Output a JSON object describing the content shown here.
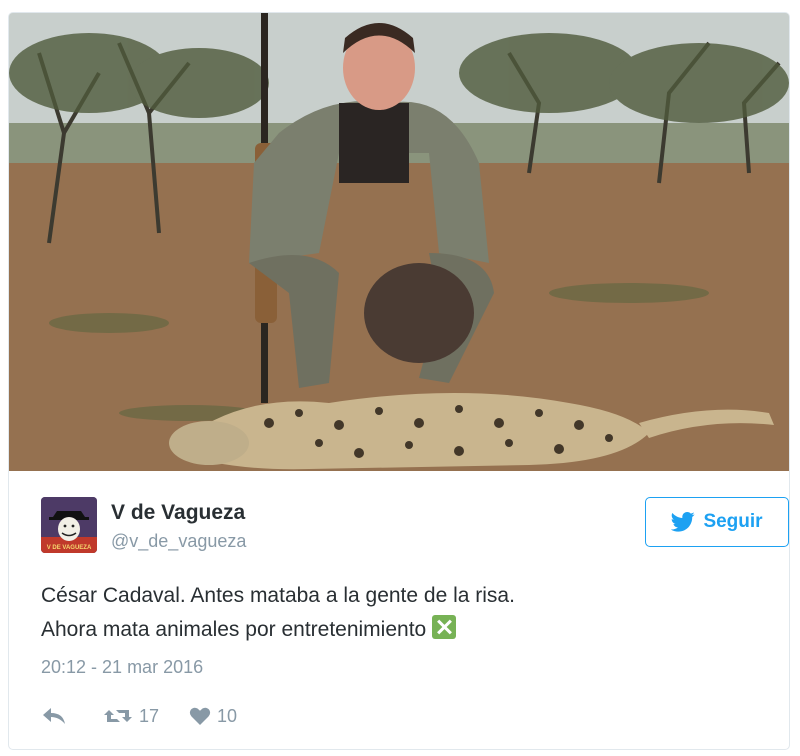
{
  "tweet": {
    "author_name": "V de Vagueza",
    "author_handle": "@v_de_vagueza",
    "avatar_caption": "V DE VAGUEZA",
    "text_line1": "César Cadaval. Antes mataba a la gente de la risa.",
    "text_line2": "Ahora mata animales por entretenimiento",
    "emoji": "cross-mark-button",
    "timestamp": "20:12 - 21 mar 2016",
    "follow_label": "Seguir",
    "retweet_count": "17",
    "like_count": "10"
  },
  "colors": {
    "accent": "#1da1f2",
    "text": "#292f33",
    "muted": "#8899a6",
    "border": "#e1e8ed",
    "emoji_green": "#77b255"
  },
  "icons": {
    "follow": "twitter-bird-icon",
    "reply": "reply-arrow-icon",
    "retweet": "retweet-icon",
    "like": "heart-icon"
  }
}
